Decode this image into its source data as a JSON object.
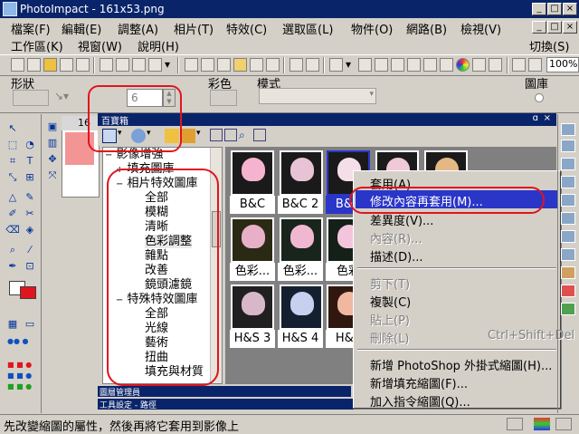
{
  "window": {
    "title": "PhotoImpact - 161x53.png",
    "controls": {
      "minimize": "_",
      "restore": "□",
      "close": "×"
    }
  },
  "menubar": {
    "row1": [
      "檔案(F)",
      "編輯(E)",
      "調整(A)",
      "相片(T)",
      "特效(C)",
      "選取區(L)",
      "物件(O)",
      "網路(B)",
      "檢視(V)"
    ],
    "row2": [
      "工作區(K)",
      "視窗(W)",
      "說明(H)"
    ],
    "switch_label": "切換(S)"
  },
  "toolbar": {
    "zoom": "100%"
  },
  "attributebar": {
    "shape_label": "形狀",
    "color_label": "彩色",
    "mode_label": "模式",
    "size_value": "6",
    "gallery_label": "圖庫"
  },
  "canvas_tab": {
    "label": "16"
  },
  "panel": {
    "title": "百寶箱",
    "close": "×",
    "tree": [
      {
        "label": "影像增強",
        "toggle": "−"
      },
      {
        "label": "填充圖庫",
        "toggle": "+"
      },
      {
        "label": "相片特效圖庫",
        "toggle": "−"
      },
      {
        "label": "全部"
      },
      {
        "label": "模糊"
      },
      {
        "label": "清晰"
      },
      {
        "label": "色彩調整"
      },
      {
        "label": "雜點"
      },
      {
        "label": "改善"
      },
      {
        "label": "鏡頭濾鏡"
      },
      {
        "label": "特殊特效圖庫",
        "toggle": "−"
      },
      {
        "label": "全部"
      },
      {
        "label": "光線"
      },
      {
        "label": "藝術"
      },
      {
        "label": "扭曲"
      },
      {
        "label": "填充與材質"
      }
    ],
    "gallery": {
      "row1_captions": [
        "B&C",
        "B&C 2",
        "B&C"
      ],
      "row2_captions": [
        "色彩...",
        "色彩...",
        "色彩"
      ],
      "row3_captions": [
        "H&S 3",
        "H&S 4",
        "H&S"
      ]
    },
    "bottom_tabs": [
      "圖層管理員",
      "工具設定 - 路徑"
    ]
  },
  "context_menu": {
    "items": [
      {
        "label": "套用(A)",
        "enabled": true
      },
      {
        "label": "修改內容再套用(M)...",
        "enabled": true,
        "highlighted": true
      },
      {
        "label": "差異度(V)...",
        "enabled": true
      },
      {
        "label": "內容(R)...",
        "enabled": false
      },
      {
        "label": "描述(D)...",
        "enabled": true
      },
      {
        "label": "剪下(T)",
        "enabled": false
      },
      {
        "label": "複製(C)",
        "enabled": true
      },
      {
        "label": "貼上(P)",
        "enabled": false
      },
      {
        "label": "刪除(L)",
        "enabled": false,
        "shortcut": "Ctrl+Shift+Del"
      },
      {
        "label": "新增 PhotoShop 外掛式縮圖(H)...",
        "enabled": true
      },
      {
        "label": "新增填充縮圖(F)...",
        "enabled": true
      },
      {
        "label": "加入指令縮圖(Q)...",
        "enabled": true
      }
    ]
  },
  "statusbar": {
    "text": "先改變縮圖的屬性，然後再將它套用到影像上"
  },
  "colors": {
    "title_bg": "#0a246a",
    "window_bg": "#d4d0c8",
    "highlight": "#2a36c8",
    "annotation": "#e0151e"
  }
}
